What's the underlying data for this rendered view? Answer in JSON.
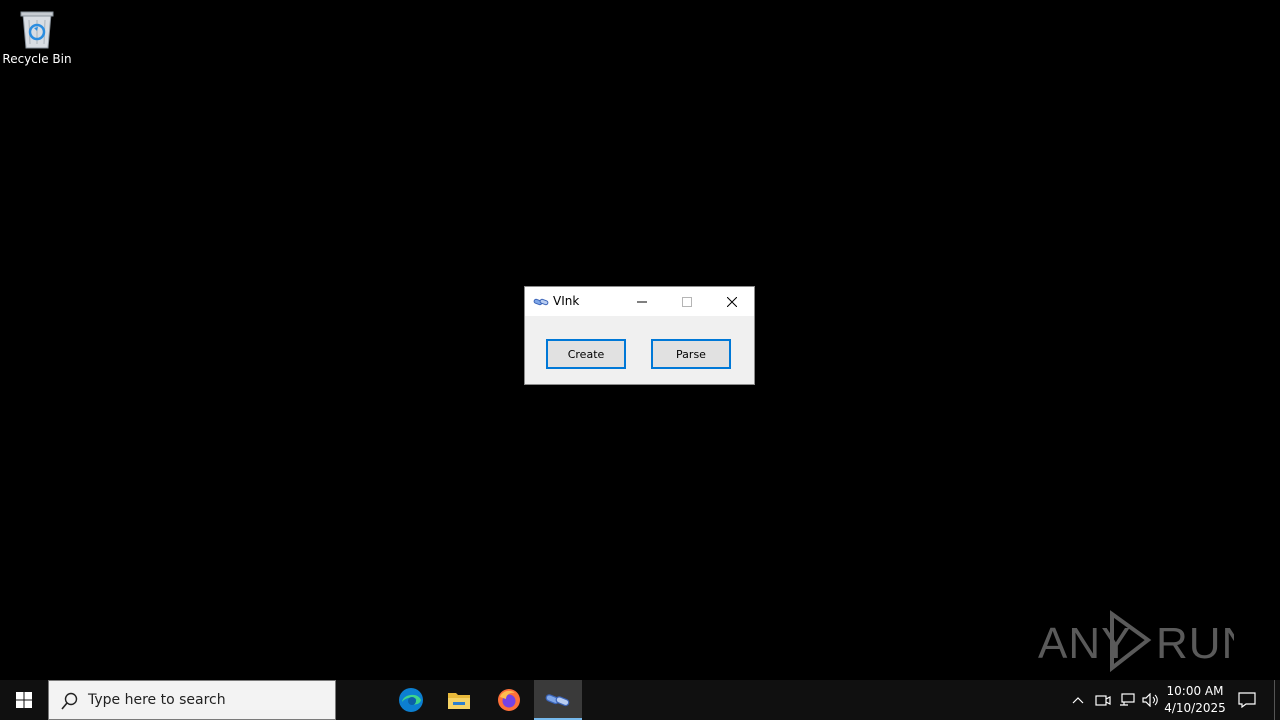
{
  "desktop": {
    "icons": [
      {
        "label": "Recycle Bin",
        "icon": "recycle-bin-icon"
      }
    ]
  },
  "window": {
    "title": "VInk",
    "icon": "link-icon",
    "buttons": {
      "create_label": "Create",
      "parse_label": "Parse"
    }
  },
  "watermark": {
    "text": "ANY RUN"
  },
  "taskbar": {
    "search_placeholder": "Type here to search",
    "apps": [
      {
        "name": "Microsoft Edge",
        "icon": "edge-icon"
      },
      {
        "name": "File Explorer",
        "icon": "folder-icon"
      },
      {
        "name": "Firefox",
        "icon": "firefox-icon"
      },
      {
        "name": "VInk",
        "icon": "link-icon",
        "active": true
      }
    ],
    "clock": {
      "time": "10:00 AM",
      "date": "4/10/2025"
    }
  },
  "colors": {
    "accent": "#0078d7",
    "desktop_bg": "#000000",
    "taskbar_bg": "#101010"
  }
}
